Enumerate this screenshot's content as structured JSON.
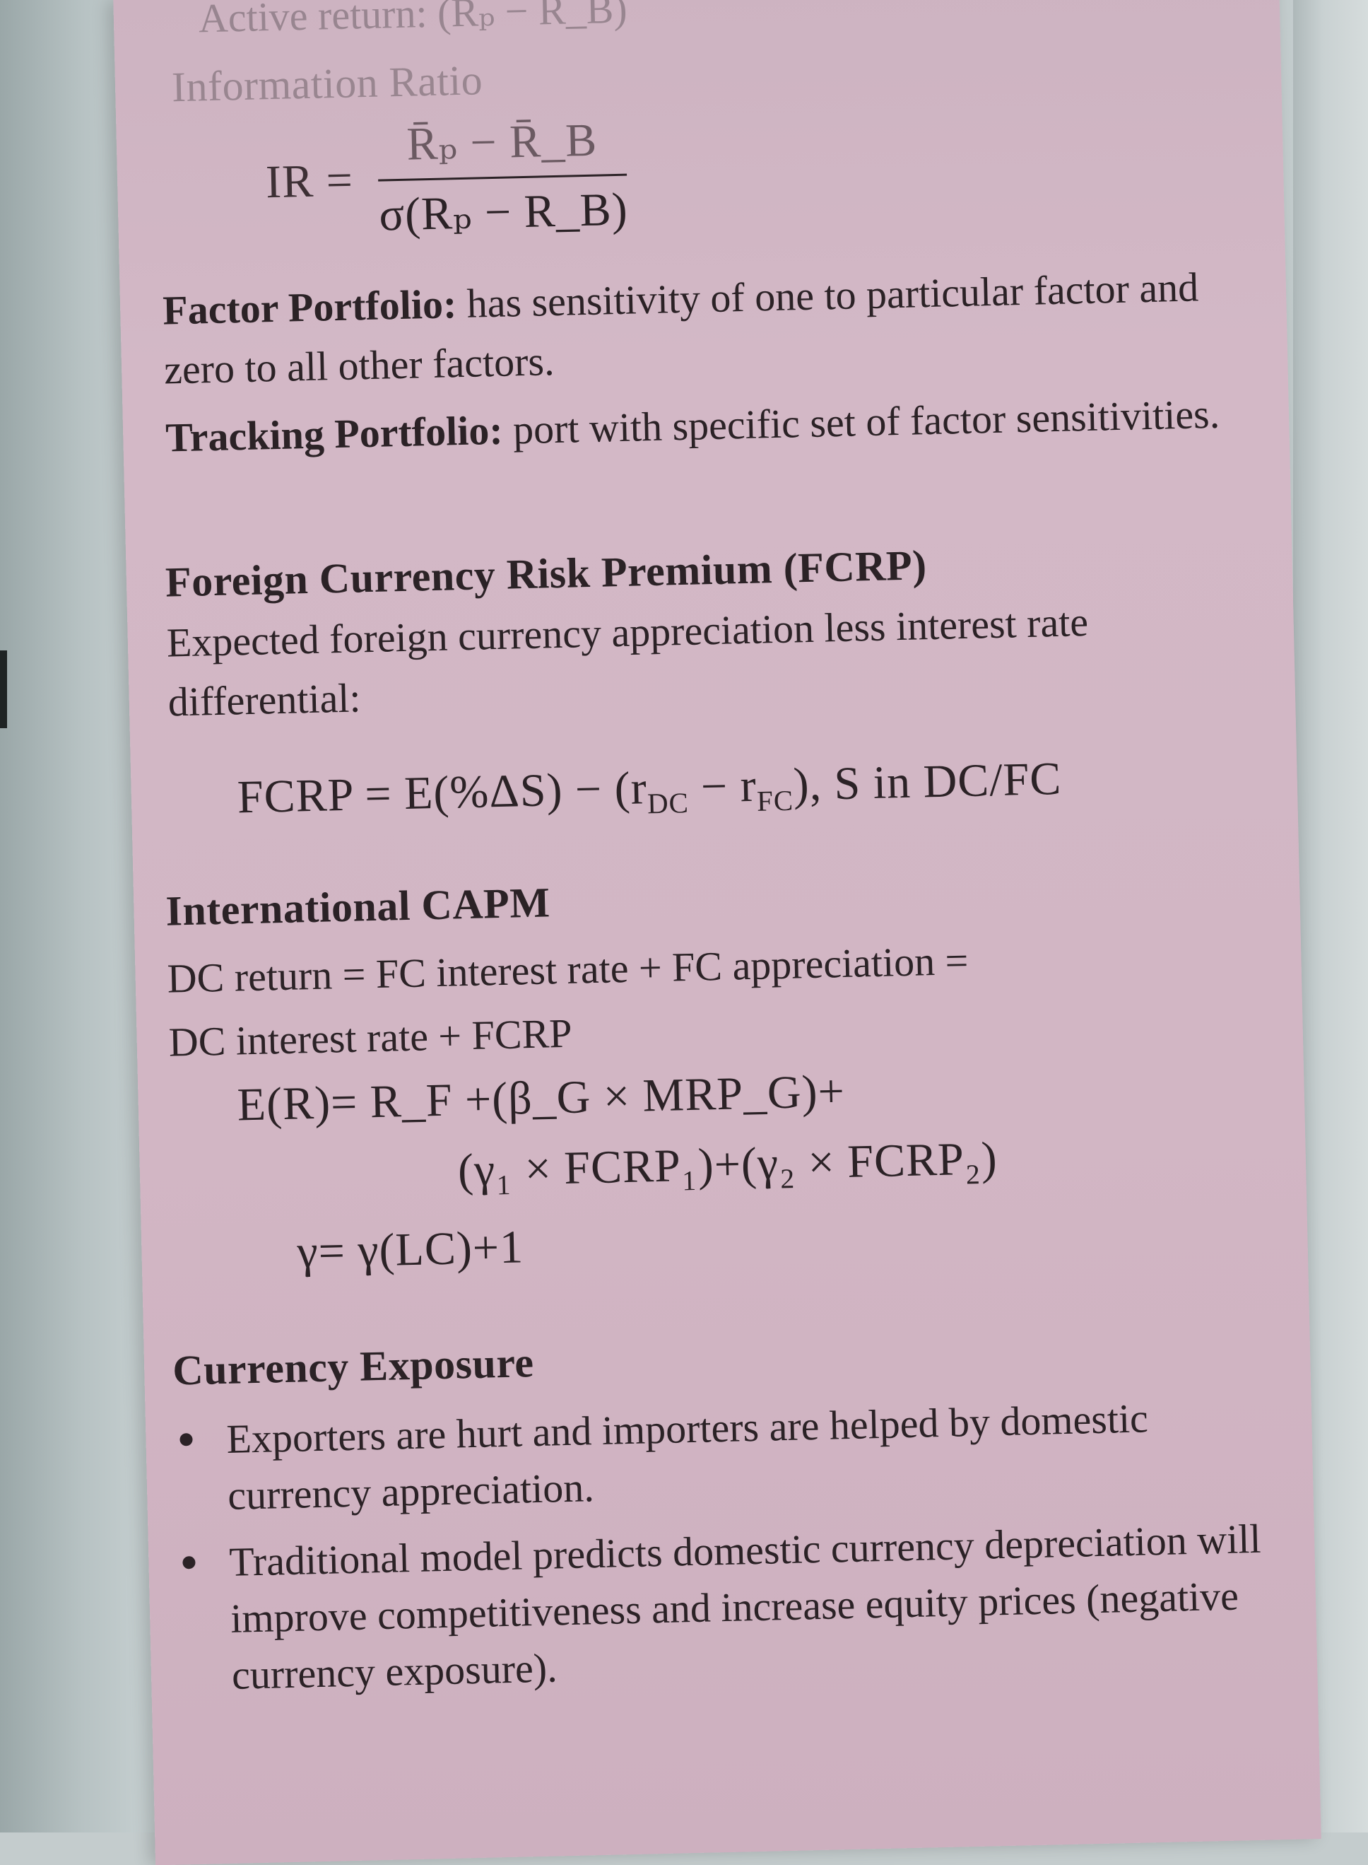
{
  "top_block": {
    "active_return": "Active return: (Rₚ − R_B)",
    "info_ratio_title": "Information Ratio",
    "ir_lhs": "IR =",
    "ir_numerator": "R̄ₚ − R̄_B",
    "ir_denominator": "σ(Rₚ − R_B)"
  },
  "factor_portfolio": {
    "term": "Factor Portfolio:",
    "definition": "has sensitivity of one to particular factor and zero to all other factors."
  },
  "tracking_portfolio": {
    "term": "Tracking Portfolio:",
    "definition": "port with specific set of factor sensitivities."
  },
  "fcrp": {
    "heading": "Foreign Currency Risk Premium (FCRP)",
    "description": "Expected foreign currency appreciation less interest rate differential:",
    "formula_a": "FCRP = E(%ΔS) − (r",
    "formula_sub1": "DC",
    "formula_b": " − r",
    "formula_sub2": "FC",
    "formula_c": "), S in DC/FC"
  },
  "intl_capm": {
    "heading": "International CAPM",
    "line1": "DC return = FC interest rate + FC appreciation =",
    "line2": "DC interest rate + FCRP",
    "eq1": "E(R)= R_F +(β_G × MRP_G)+",
    "eq2": "(γ₁ × FCRP₁)+(γ₂ × FCRP₂)",
    "eq3": "γ= γ(LC)+1"
  },
  "currency_exposure": {
    "heading": "Currency Exposure",
    "bullets": [
      "Exporters are hurt and importers are helped by domestic currency appreciation.",
      "Traditional model predicts domestic currency depreciation will improve competitiveness and increase equity prices (negative currency exposure)."
    ]
  }
}
